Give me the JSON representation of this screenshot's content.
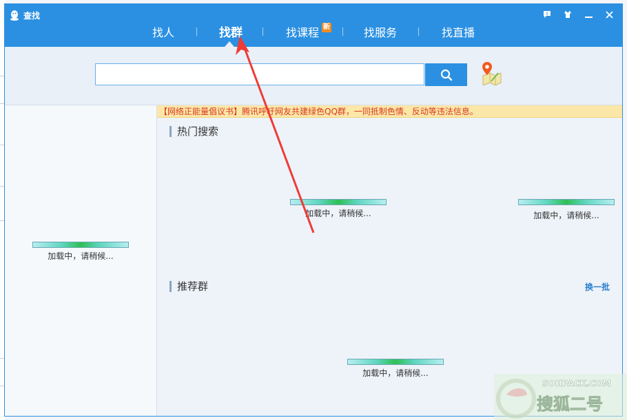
{
  "window": {
    "title": "查找",
    "controls": [
      "feedback",
      "skin",
      "minimize",
      "close"
    ]
  },
  "tabs": [
    {
      "label": "找人",
      "active": false
    },
    {
      "label": "找群",
      "active": true
    },
    {
      "label": "找课程",
      "active": false,
      "badge": "新"
    },
    {
      "label": "找服务",
      "active": false
    },
    {
      "label": "找直播",
      "active": false
    }
  ],
  "search": {
    "value": "",
    "placeholder": "",
    "button_icon": "search-icon",
    "location_icon": "map-location-icon"
  },
  "notice": "【网络正能量倡议书】腾讯呼吁网友共建绿色QQ群，一同抵制色情、反动等违法信息。",
  "sections": {
    "hot_search": {
      "title": "热门搜索"
    },
    "recommended": {
      "title": "推荐群",
      "refresh_label": "换一批"
    }
  },
  "loading_text": "加载中，请稍候...",
  "loaders": [
    {
      "id": "left-panel",
      "progress": 1.0
    },
    {
      "id": "hot-search-1",
      "progress": 1.0
    },
    {
      "id": "hot-search-2",
      "progress": 1.0
    },
    {
      "id": "recommended",
      "progress": 1.0
    }
  ],
  "watermark": {
    "text": "SOHPACK.COM",
    "cn": "搜狐二号"
  },
  "colors": {
    "titlebar": "#2b90e2",
    "notice_bg": "#fbe7a8",
    "notice_text": "#d83a1f",
    "annotation_arrow": "#ef3b36",
    "new_badge": "#f28a1f"
  }
}
